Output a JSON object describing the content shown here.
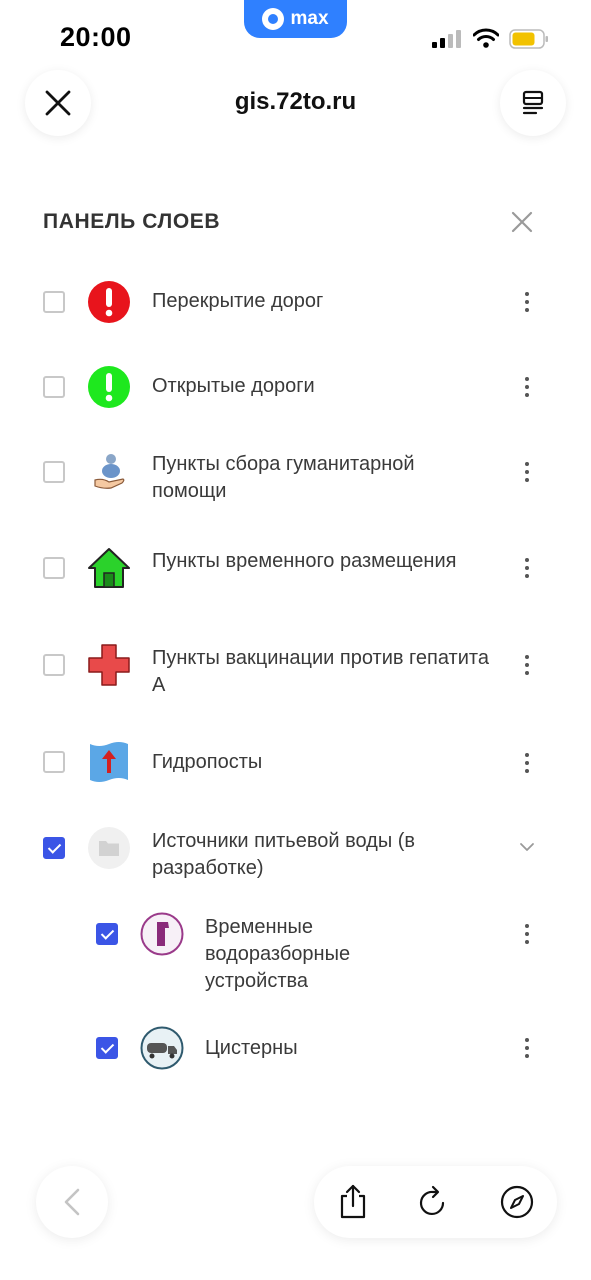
{
  "status": {
    "time": "20:00",
    "app_badge": "max"
  },
  "browser": {
    "url": "gis.72to.ru",
    "close_icon": "close-icon",
    "tabs_icon": "tabs-icon"
  },
  "panel": {
    "title": "ПАНЕЛЬ СЛОЕВ",
    "layers": [
      {
        "label": "Перекрытие дорог",
        "checked": false,
        "icon": "red-exclamation-icon"
      },
      {
        "label": "Открытые дороги",
        "checked": false,
        "icon": "green-exclamation-icon"
      },
      {
        "label": "Пункты сбора гуманитарной помощи",
        "checked": false,
        "icon": "humanitarian-aid-icon"
      },
      {
        "label": "Пункты временного размещения",
        "checked": false,
        "icon": "house-icon"
      },
      {
        "label": "Пункты вакцинации против гепатита А",
        "checked": false,
        "icon": "red-cross-icon"
      },
      {
        "label": "Гидропосты",
        "checked": false,
        "icon": "hydropost-icon"
      },
      {
        "label": "Источники питьевой воды (в разработке)",
        "checked": true,
        "icon": "folder-icon",
        "expanded": true,
        "children": [
          {
            "label": "Временные водоразборные устройства",
            "checked": true,
            "icon": "water-tap-icon"
          },
          {
            "label": "Цистерны",
            "checked": true,
            "icon": "tanker-truck-icon"
          }
        ]
      }
    ]
  },
  "toolbar": {
    "back_icon": "back-icon",
    "share_icon": "share-icon",
    "reload_icon": "reload-icon",
    "compass_icon": "compass-icon"
  },
  "colors": {
    "accent": "#3b55e6",
    "max_blue": "#2f80ff",
    "road_closed": "#e8141c",
    "road_open": "#1ee81e",
    "house": "#2bd22b",
    "cross": "#e84a4a"
  }
}
